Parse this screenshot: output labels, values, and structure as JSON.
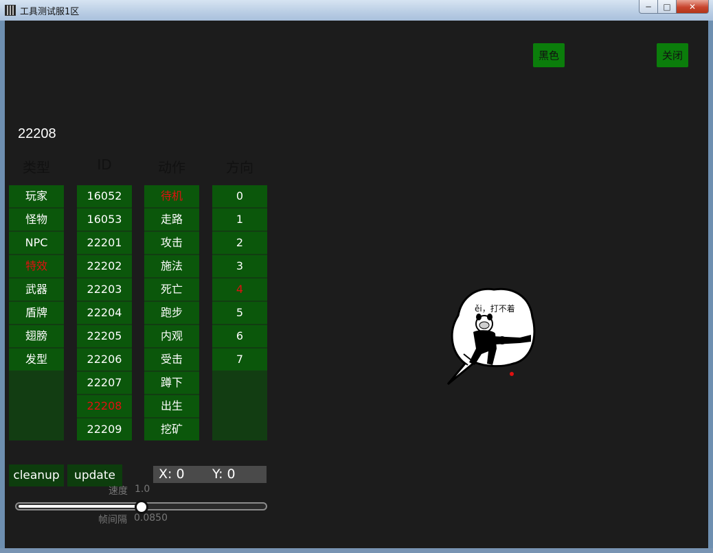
{
  "window": {
    "title": "工具测试服1区",
    "minimize_glyph": "─",
    "maximize_glyph": "□",
    "close_glyph": "✕"
  },
  "toolbar": {
    "black_label": "黑色",
    "close_label": "关闭"
  },
  "current_id": "22208",
  "columns": [
    {
      "header": "类型",
      "items": [
        "玩家",
        "怪物",
        "NPC",
        "特效",
        "武器",
        "盾牌",
        "翅膀",
        "发型"
      ],
      "selected": 3
    },
    {
      "header": "ID",
      "items": [
        "16052",
        "16053",
        "22201",
        "22202",
        "22203",
        "22204",
        "22205",
        "22206",
        "22207",
        "22208",
        "22209"
      ],
      "selected": 9
    },
    {
      "header": "动作",
      "items": [
        "待机",
        "走路",
        "攻击",
        "施法",
        "死亡",
        "跑步",
        "内观",
        "受击",
        "蹲下",
        "出生",
        "挖矿"
      ],
      "selected": 0
    },
    {
      "header": "方向",
      "items": [
        "0",
        "1",
        "2",
        "3",
        "4",
        "5",
        "6",
        "7"
      ],
      "selected": 4
    }
  ],
  "actions": {
    "cleanup_label": "cleanup",
    "update_label": "update"
  },
  "coords": {
    "x_text": "X: 0",
    "y_text": "Y: 0"
  },
  "speed": {
    "label": "速度",
    "value": "1.0",
    "slider_fraction": 0.5
  },
  "interval": {
    "label": "帧间隔",
    "value": "0.0850"
  },
  "sprite": {
    "bubble_text": "ěi，打不着",
    "icon": "panda-meme-speech-bubble"
  },
  "colors": {
    "cell_bg": "#0b570b",
    "column_bg": "#123d12",
    "selected_text": "#e01010",
    "top_button": "#0b7d0b",
    "client_bg": "#1c1c1c"
  }
}
